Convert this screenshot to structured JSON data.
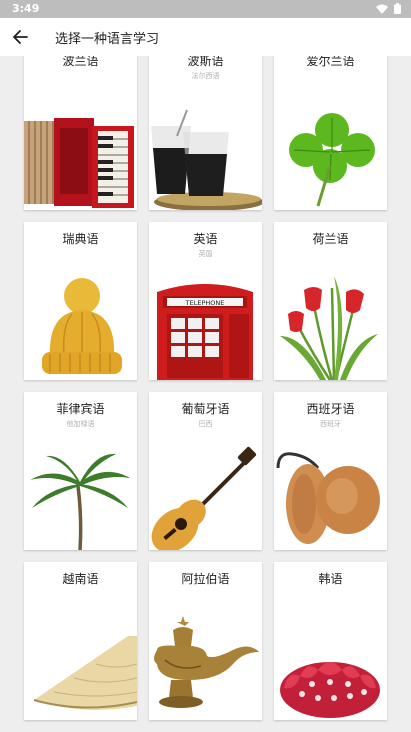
{
  "status": {
    "time": "3:49",
    "icons": [
      "wifi-icon",
      "battery-icon"
    ]
  },
  "header": {
    "title": "选择一种语言学习",
    "back_icon": "arrow-left-icon"
  },
  "languages": [
    {
      "name": "波兰语",
      "subtitle": "",
      "image": "accordion"
    },
    {
      "name": "波斯语",
      "subtitle": "法尔西语",
      "image": "tea-glasses"
    },
    {
      "name": "爱尔兰语",
      "subtitle": "",
      "image": "shamrock"
    },
    {
      "name": "瑞典语",
      "subtitle": "",
      "image": "knit-hat"
    },
    {
      "name": "英语",
      "subtitle": "英国",
      "image": "telephone-box"
    },
    {
      "name": "荷兰语",
      "subtitle": "",
      "image": "tulips"
    },
    {
      "name": "菲律宾语",
      "subtitle": "他加禄语",
      "image": "palm-tree"
    },
    {
      "name": "葡萄牙语",
      "subtitle": "巴西",
      "image": "guitar"
    },
    {
      "name": "西班牙语",
      "subtitle": "西班牙",
      "image": "castanets"
    },
    {
      "name": "越南语",
      "subtitle": "",
      "image": "conical-hat"
    },
    {
      "name": "阿拉伯语",
      "subtitle": "",
      "image": "genie-lamp"
    },
    {
      "name": "韩语",
      "subtitle": "",
      "image": "lotus"
    }
  ],
  "image_text": {
    "telephone_sign": "TELEPHONE"
  }
}
